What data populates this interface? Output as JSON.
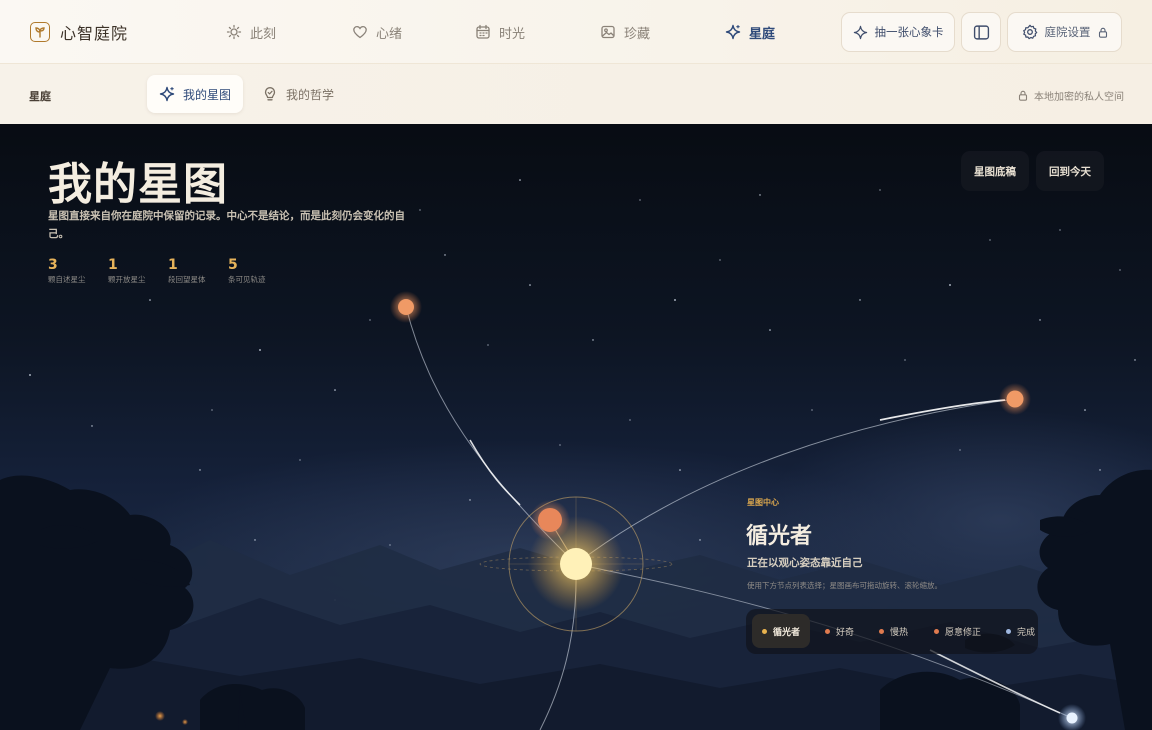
{
  "brand": {
    "name": "心智庭院"
  },
  "nav": {
    "items": [
      {
        "label": "此刻",
        "icon": "sun-icon"
      },
      {
        "label": "心绪",
        "icon": "heart-icon"
      },
      {
        "label": "时光",
        "icon": "calendar-icon"
      },
      {
        "label": "珍藏",
        "icon": "image-icon"
      },
      {
        "label": "星庭",
        "icon": "sparkle-icon",
        "active": true
      }
    ]
  },
  "actions": {
    "draw_card": "抽一张心象卡",
    "settings": "庭院设置"
  },
  "subnav": {
    "section": "星庭",
    "tabs": [
      {
        "label": "我的星图",
        "icon": "sparkle-icon",
        "active": true
      },
      {
        "label": "我的哲学",
        "icon": "lightbulb-icon"
      }
    ],
    "privacy": "本地加密的私人空间"
  },
  "starmap": {
    "title": "我的星图",
    "description": "星图直接来自你在庭院中保留的记录。中心不是结论，而是此刻仍会变化的自己。",
    "stats": [
      {
        "value": "3",
        "label": "颗自述星尘"
      },
      {
        "value": "1",
        "label": "颗开放星尘"
      },
      {
        "value": "1",
        "label": "段回望星体"
      },
      {
        "value": "5",
        "label": "条可见轨迹"
      }
    ],
    "buttons": {
      "draft": "星图底稿",
      "today": "回到今天"
    }
  },
  "center_panel": {
    "eyebrow": "星图中心",
    "title": "循光者",
    "subtitle": "正在以观心姿态靠近自己",
    "hint": "使用下方节点列表选择；星图画布可拖动旋转、滚轮缩放。",
    "chips": [
      {
        "label": "循光者",
        "color": "#e8b24e",
        "active": true
      },
      {
        "label": "好奇",
        "color": "#e07b4f"
      },
      {
        "label": "慢热",
        "color": "#e07b4f"
      },
      {
        "label": "愿意修正",
        "color": "#e07b4f"
      },
      {
        "label": "完成",
        "color": "#9fb7e0"
      }
    ]
  },
  "colors": {
    "accent": "#2f4a7a",
    "gold": "#e6b35a",
    "star_orange": "#e8875a",
    "star_core": "#fff1b8"
  }
}
